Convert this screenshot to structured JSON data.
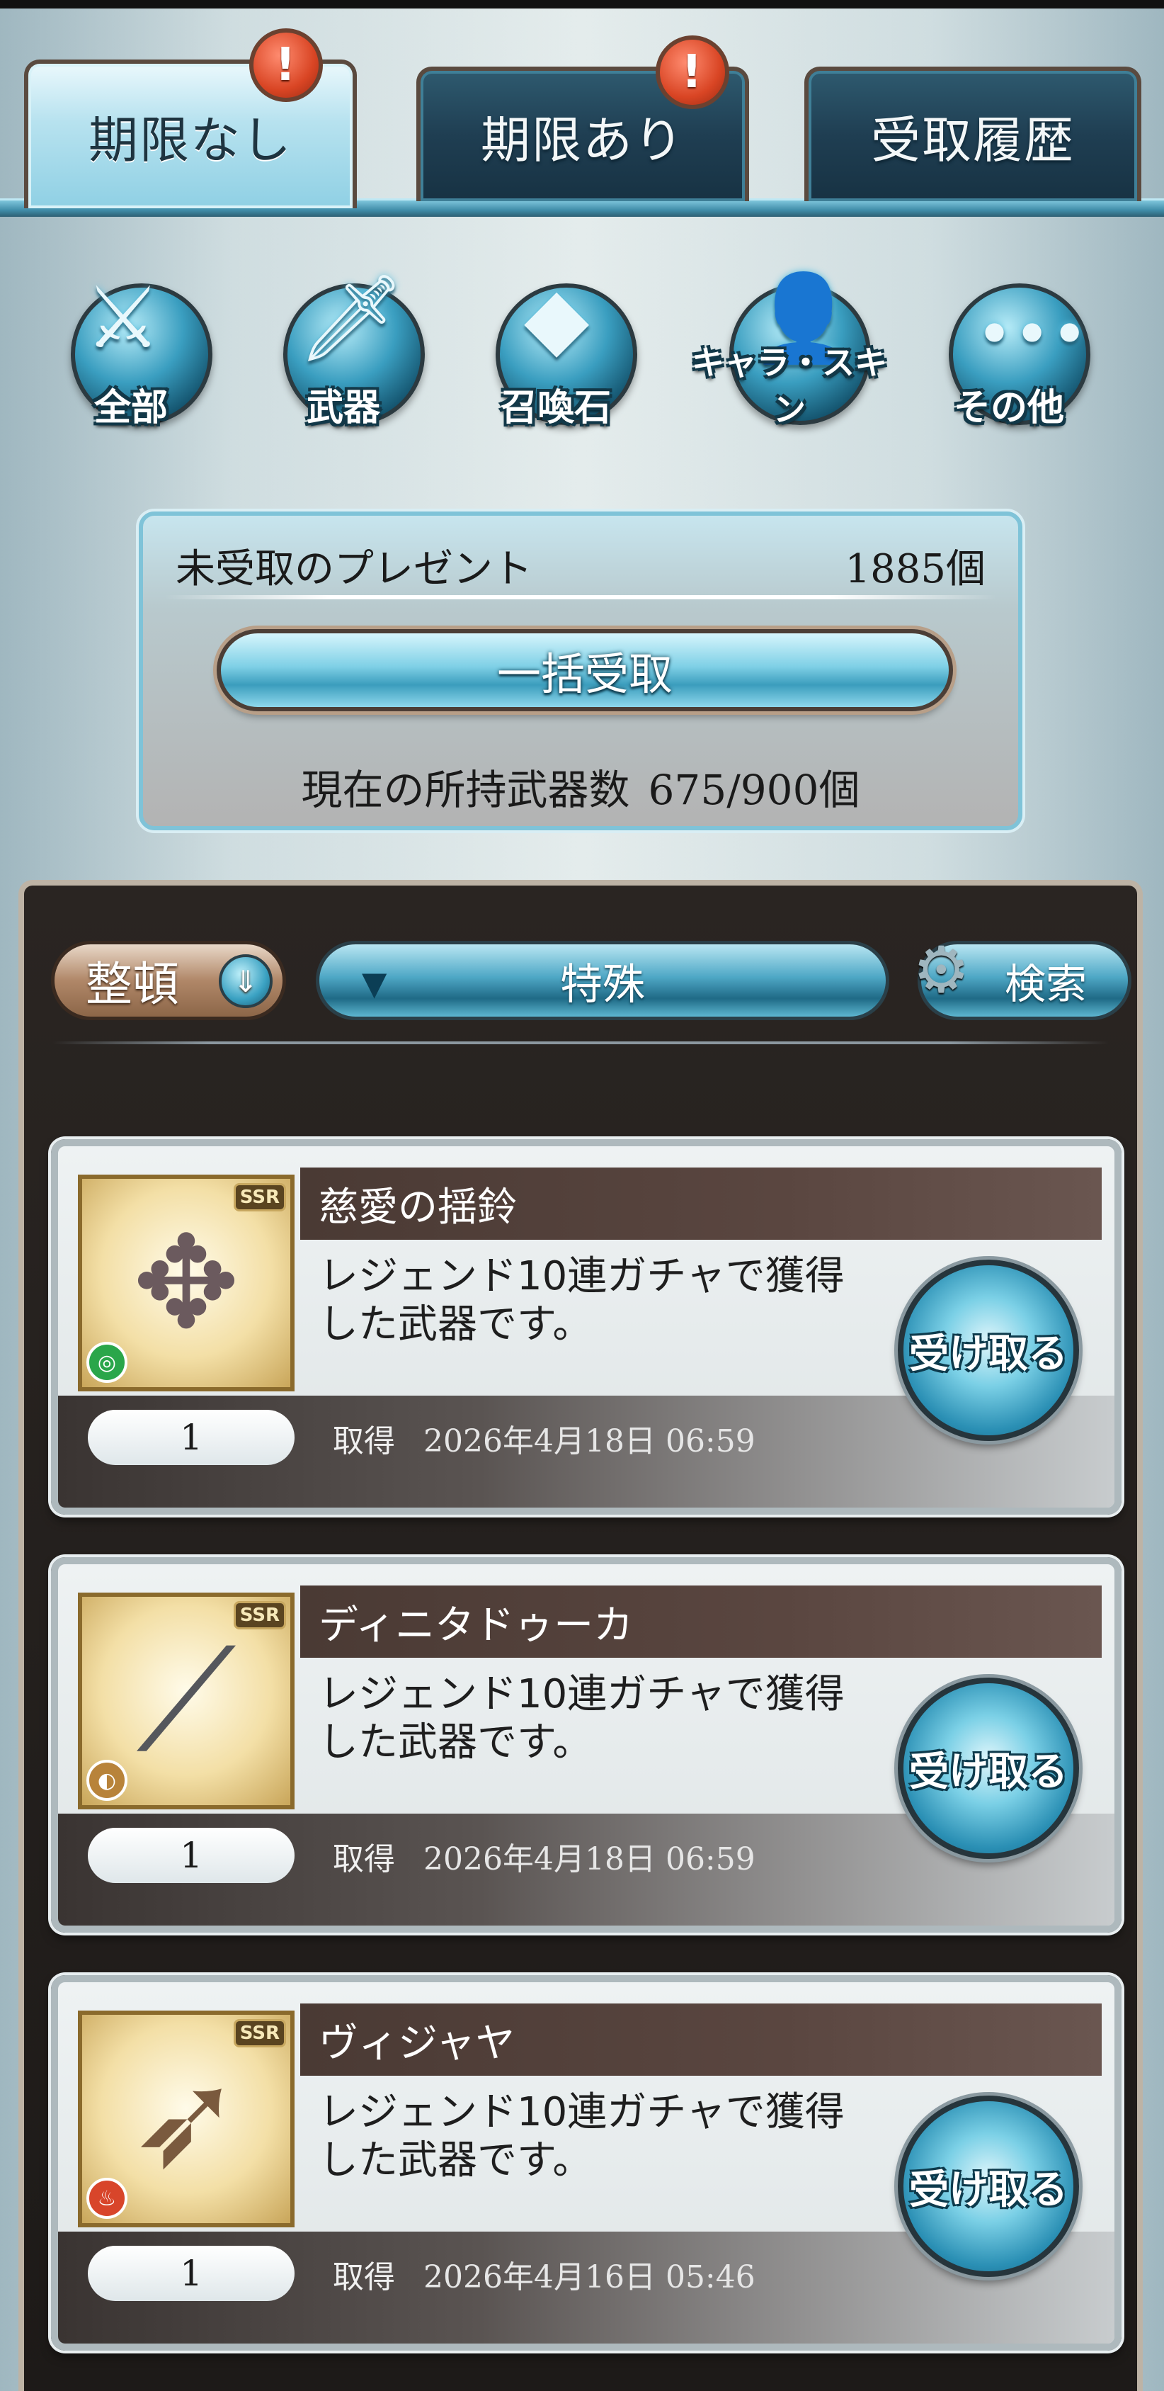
{
  "tabs": [
    {
      "label": "期限なし",
      "active": true,
      "badge": "!"
    },
    {
      "label": "期限あり",
      "active": false,
      "badge": "!"
    },
    {
      "label": "受取履歴",
      "active": false
    }
  ],
  "categories": [
    {
      "label": "全部",
      "icon": "all-items-icon"
    },
    {
      "label": "武器",
      "icon": "sword-icon"
    },
    {
      "label": "召喚石",
      "icon": "crystal-icon"
    },
    {
      "label": "キャラ・スキン",
      "icon": "character-icon"
    },
    {
      "label": "その他",
      "icon": "more-dots-icon"
    }
  ],
  "summary": {
    "title": "未受取のプレゼント",
    "count": "1885個",
    "bulk_label": "一括受取",
    "holdings_label": "現在の所持武器数",
    "holdings_value": "675/900個"
  },
  "filters": {
    "sort_label": "整頓",
    "filter_label": "特殊",
    "search_label": "検索"
  },
  "items": [
    {
      "name": "慈愛の揺鈴",
      "desc": "レジェンド10連ガチャで獲得した武器です。",
      "qty": "1",
      "got_label": "取得",
      "date": "2026年4月18日 06:59",
      "rarity": "SSR",
      "element_color": "#2aa64a",
      "recv_label": "受け取る"
    },
    {
      "name": "ディニタドゥーカ",
      "desc": "レジェンド10連ガチャで獲得した武器です。",
      "qty": "1",
      "got_label": "取得",
      "date": "2026年4月18日 06:59",
      "rarity": "SSR",
      "element_color": "#b8833a",
      "recv_label": "受け取る"
    },
    {
      "name": "ヴィジャヤ",
      "desc": "レジェンド10連ガチャで獲得した武器です。",
      "qty": "1",
      "got_label": "取得",
      "date": "2026年4月16日 05:46",
      "rarity": "SSR",
      "element_color": "#d8452a",
      "recv_label": "受け取る"
    }
  ]
}
